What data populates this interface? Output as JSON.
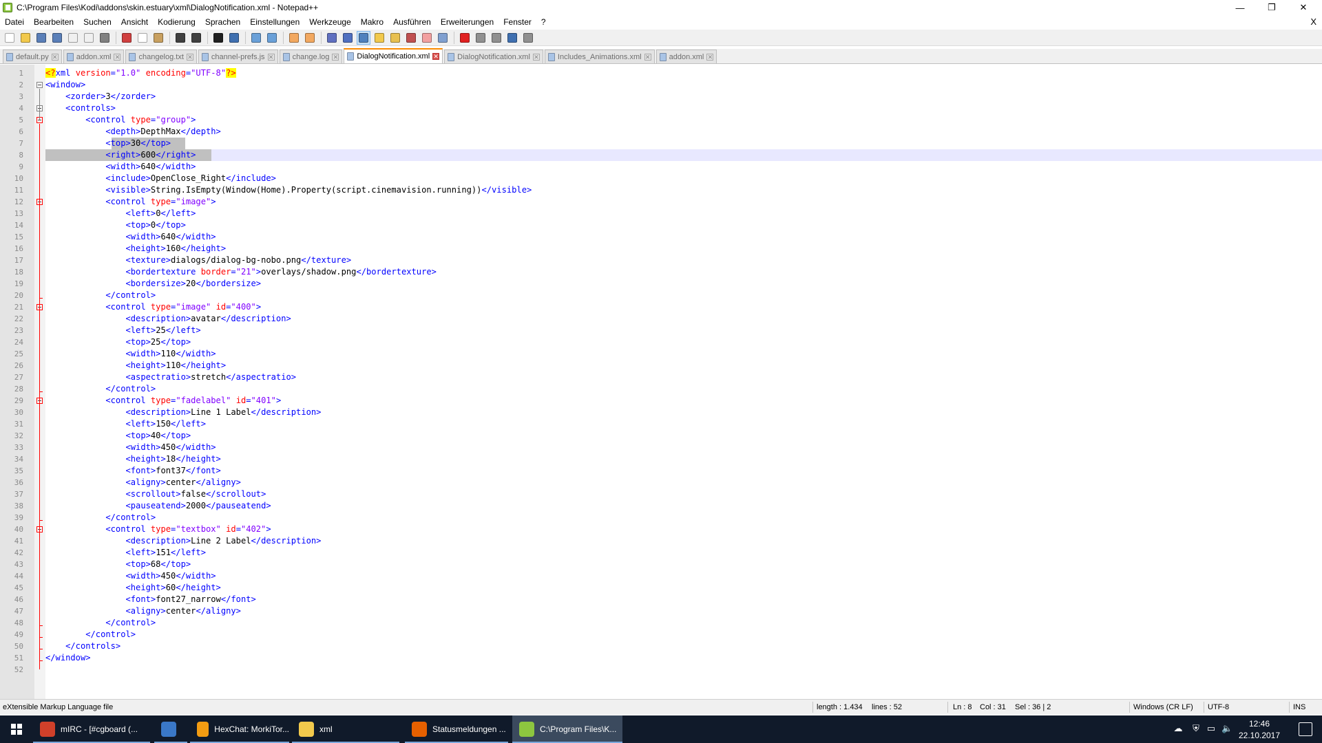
{
  "window": {
    "title": "C:\\Program Files\\Kodi\\addons\\skin.estuary\\xml\\DialogNotification.xml - Notepad++",
    "min_glyph": "—",
    "max_glyph": "❐",
    "close_glyph": "✕"
  },
  "menu": {
    "items": [
      "Datei",
      "Bearbeiten",
      "Suchen",
      "Ansicht",
      "Kodierung",
      "Sprachen",
      "Einstellungen",
      "Werkzeuge",
      "Makro",
      "Ausführen",
      "Erweiterungen",
      "Fenster",
      "?"
    ],
    "close_glyph": "X"
  },
  "toolbar": {
    "icons": [
      {
        "name": "new-file-icon",
        "color": "#ffffff"
      },
      {
        "name": "open-file-icon",
        "color": "#f2c94c"
      },
      {
        "name": "save-icon",
        "color": "#5a7fb8"
      },
      {
        "name": "save-all-icon",
        "color": "#5a7fb8"
      },
      {
        "name": "close-icon",
        "color": "#f0f0f0"
      },
      {
        "name": "close-all-icon",
        "color": "#f0f0f0"
      },
      {
        "name": "print-icon",
        "color": "#808080"
      },
      {
        "sep": true
      },
      {
        "name": "cut-icon",
        "color": "#d04040"
      },
      {
        "name": "copy-icon",
        "color": "#ffffff"
      },
      {
        "name": "paste-icon",
        "color": "#c8a060"
      },
      {
        "sep": true
      },
      {
        "name": "undo-icon",
        "color": "#404040"
      },
      {
        "name": "redo-icon",
        "color": "#404040"
      },
      {
        "sep": true
      },
      {
        "name": "find-icon",
        "color": "#202020"
      },
      {
        "name": "replace-icon",
        "color": "#4070b0"
      },
      {
        "sep": true
      },
      {
        "name": "zoom-in-icon",
        "color": "#6aa0d8"
      },
      {
        "name": "zoom-out-icon",
        "color": "#6aa0d8"
      },
      {
        "sep": true
      },
      {
        "name": "sync-vertical-icon",
        "color": "#f2a860"
      },
      {
        "name": "sync-horizontal-icon",
        "color": "#f2a860"
      },
      {
        "sep": true
      },
      {
        "name": "word-wrap-icon",
        "color": "#6070c0"
      },
      {
        "name": "show-all-chars-icon",
        "color": "#5070c0"
      },
      {
        "name": "indent-guide-icon",
        "color": "#4f81bd",
        "active": true
      },
      {
        "name": "lang-define-icon",
        "color": "#f2c94c"
      },
      {
        "name": "doc-map-icon",
        "color": "#e8c050"
      },
      {
        "name": "function-list-icon",
        "color": "#c05050"
      },
      {
        "name": "folder-workspace-icon",
        "color": "#f2a0a0"
      },
      {
        "name": "monitoring-icon",
        "color": "#80a0d0"
      },
      {
        "sep": true
      },
      {
        "name": "macro-record-icon",
        "color": "#e02020"
      },
      {
        "name": "macro-stop-icon",
        "color": "#909090"
      },
      {
        "name": "macro-play-icon",
        "color": "#909090"
      },
      {
        "name": "macro-run-multiple-icon",
        "color": "#4070b0"
      },
      {
        "name": "macro-save-icon",
        "color": "#909090"
      }
    ]
  },
  "tabs": [
    {
      "label": "default.py",
      "active": false,
      "icon": "blue"
    },
    {
      "label": "addon.xml",
      "active": false,
      "icon": "blue"
    },
    {
      "label": "changelog.txt",
      "active": false,
      "icon": "blue"
    },
    {
      "label": "channel-prefs.js",
      "active": false,
      "icon": "blue"
    },
    {
      "label": "change.log",
      "active": false,
      "icon": "blue"
    },
    {
      "label": "DialogNotification.xml",
      "active": true,
      "icon": "blue"
    },
    {
      "label": "DialogNotification.xml",
      "active": false,
      "icon": "blue"
    },
    {
      "label": "Includes_Animations.xml",
      "active": false,
      "icon": "blue"
    },
    {
      "label": "addon.xml",
      "active": false,
      "icon": "blue"
    }
  ],
  "tab_close_glyph": "✕",
  "editor": {
    "current_line": 8,
    "lines": [
      [
        [
          "pihl",
          "<?"
        ],
        [
          "pi",
          "xml "
        ],
        [
          "attr",
          "version"
        ],
        [
          "pi",
          "="
        ],
        [
          "val",
          "\"1.0\""
        ],
        [
          "pi",
          " "
        ],
        [
          "attr",
          "encoding"
        ],
        [
          "pi",
          "="
        ],
        [
          "val",
          "\"UTF-8\""
        ],
        [
          "pihl",
          "?>"
        ]
      ],
      [
        [
          "tag",
          "<window>"
        ]
      ],
      [
        [
          "ws",
          "    "
        ],
        [
          "tag",
          "<zorder>"
        ],
        [
          "text",
          "3"
        ],
        [
          "tag",
          "</zorder>"
        ]
      ],
      [
        [
          "ws",
          "    "
        ],
        [
          "tag",
          "<controls>"
        ]
      ],
      [
        [
          "ws",
          "        "
        ],
        [
          "tag",
          "<control "
        ],
        [
          "attr",
          "type"
        ],
        [
          "tag",
          "="
        ],
        [
          "val",
          "\"group\""
        ],
        [
          "tag",
          ">"
        ]
      ],
      [
        [
          "ws",
          "            "
        ],
        [
          "tag",
          "<depth>"
        ],
        [
          "text",
          "DepthMax"
        ],
        [
          "tag",
          "</depth>"
        ]
      ],
      [
        [
          "ws",
          "            "
        ],
        [
          "tag",
          "<top>"
        ],
        [
          "text",
          "30"
        ],
        [
          "tag",
          "</top>"
        ]
      ],
      [
        [
          "ws",
          "            "
        ],
        [
          "tag",
          "<right>"
        ],
        [
          "text",
          "600"
        ],
        [
          "tag",
          "</right>"
        ]
      ],
      [
        [
          "ws",
          "            "
        ],
        [
          "tag",
          "<width>"
        ],
        [
          "text",
          "640"
        ],
        [
          "tag",
          "</width>"
        ]
      ],
      [
        [
          "ws",
          "            "
        ],
        [
          "tag",
          "<include>"
        ],
        [
          "text",
          "OpenClose_Right"
        ],
        [
          "tag",
          "</include>"
        ]
      ],
      [
        [
          "ws",
          "            "
        ],
        [
          "tag",
          "<visible>"
        ],
        [
          "text",
          "String.IsEmpty(Window(Home).Property(script.cinemavision.running))"
        ],
        [
          "tag",
          "</visible>"
        ]
      ],
      [
        [
          "ws",
          "            "
        ],
        [
          "tag",
          "<control "
        ],
        [
          "attr",
          "type"
        ],
        [
          "tag",
          "="
        ],
        [
          "val",
          "\"image\""
        ],
        [
          "tag",
          ">"
        ]
      ],
      [
        [
          "ws",
          "                "
        ],
        [
          "tag",
          "<left>"
        ],
        [
          "text",
          "0"
        ],
        [
          "tag",
          "</left>"
        ]
      ],
      [
        [
          "ws",
          "                "
        ],
        [
          "tag",
          "<top>"
        ],
        [
          "text",
          "0"
        ],
        [
          "tag",
          "</top>"
        ]
      ],
      [
        [
          "ws",
          "                "
        ],
        [
          "tag",
          "<width>"
        ],
        [
          "text",
          "640"
        ],
        [
          "tag",
          "</width>"
        ]
      ],
      [
        [
          "ws",
          "                "
        ],
        [
          "tag",
          "<height>"
        ],
        [
          "text",
          "160"
        ],
        [
          "tag",
          "</height>"
        ]
      ],
      [
        [
          "ws",
          "                "
        ],
        [
          "tag",
          "<texture>"
        ],
        [
          "text",
          "dialogs/dialog-bg-nobo.png"
        ],
        [
          "tag",
          "</texture>"
        ]
      ],
      [
        [
          "ws",
          "                "
        ],
        [
          "tag",
          "<bordertexture "
        ],
        [
          "attr",
          "border"
        ],
        [
          "tag",
          "="
        ],
        [
          "val",
          "\"21\""
        ],
        [
          "tag",
          ">"
        ],
        [
          "text",
          "overlays/shadow.png"
        ],
        [
          "tag",
          "</bordertexture>"
        ]
      ],
      [
        [
          "ws",
          "                "
        ],
        [
          "tag",
          "<bordersize>"
        ],
        [
          "text",
          "20"
        ],
        [
          "tag",
          "</bordersize>"
        ]
      ],
      [
        [
          "ws",
          "            "
        ],
        [
          "tag",
          "</control>"
        ]
      ],
      [
        [
          "ws",
          "            "
        ],
        [
          "tag",
          "<control "
        ],
        [
          "attr",
          "type"
        ],
        [
          "tag",
          "="
        ],
        [
          "val",
          "\"image\""
        ],
        [
          "tag",
          " "
        ],
        [
          "attr",
          "id"
        ],
        [
          "tag",
          "="
        ],
        [
          "val",
          "\"400\""
        ],
        [
          "tag",
          ">"
        ]
      ],
      [
        [
          "ws",
          "                "
        ],
        [
          "tag",
          "<description>"
        ],
        [
          "text",
          "avatar"
        ],
        [
          "tag",
          "</description>"
        ]
      ],
      [
        [
          "ws",
          "                "
        ],
        [
          "tag",
          "<left>"
        ],
        [
          "text",
          "25"
        ],
        [
          "tag",
          "</left>"
        ]
      ],
      [
        [
          "ws",
          "                "
        ],
        [
          "tag",
          "<top>"
        ],
        [
          "text",
          "25"
        ],
        [
          "tag",
          "</top>"
        ]
      ],
      [
        [
          "ws",
          "                "
        ],
        [
          "tag",
          "<width>"
        ],
        [
          "text",
          "110"
        ],
        [
          "tag",
          "</width>"
        ]
      ],
      [
        [
          "ws",
          "                "
        ],
        [
          "tag",
          "<height>"
        ],
        [
          "text",
          "110"
        ],
        [
          "tag",
          "</height>"
        ]
      ],
      [
        [
          "ws",
          "                "
        ],
        [
          "tag",
          "<aspectratio>"
        ],
        [
          "text",
          "stretch"
        ],
        [
          "tag",
          "</aspectratio>"
        ]
      ],
      [
        [
          "ws",
          "            "
        ],
        [
          "tag",
          "</control>"
        ]
      ],
      [
        [
          "ws",
          "            "
        ],
        [
          "tag",
          "<control "
        ],
        [
          "attr",
          "type"
        ],
        [
          "tag",
          "="
        ],
        [
          "val",
          "\"fadelabel\""
        ],
        [
          "tag",
          " "
        ],
        [
          "attr",
          "id"
        ],
        [
          "tag",
          "="
        ],
        [
          "val",
          "\"401\""
        ],
        [
          "tag",
          ">"
        ]
      ],
      [
        [
          "ws",
          "                "
        ],
        [
          "tag",
          "<description>"
        ],
        [
          "text",
          "Line 1 Label"
        ],
        [
          "tag",
          "</description>"
        ]
      ],
      [
        [
          "ws",
          "                "
        ],
        [
          "tag",
          "<left>"
        ],
        [
          "text",
          "150"
        ],
        [
          "tag",
          "</left>"
        ]
      ],
      [
        [
          "ws",
          "                "
        ],
        [
          "tag",
          "<top>"
        ],
        [
          "text",
          "40"
        ],
        [
          "tag",
          "</top>"
        ]
      ],
      [
        [
          "ws",
          "                "
        ],
        [
          "tag",
          "<width>"
        ],
        [
          "text",
          "450"
        ],
        [
          "tag",
          "</width>"
        ]
      ],
      [
        [
          "ws",
          "                "
        ],
        [
          "tag",
          "<height>"
        ],
        [
          "text",
          "18"
        ],
        [
          "tag",
          "</height>"
        ]
      ],
      [
        [
          "ws",
          "                "
        ],
        [
          "tag",
          "<font>"
        ],
        [
          "text",
          "font37"
        ],
        [
          "tag",
          "</font>"
        ]
      ],
      [
        [
          "ws",
          "                "
        ],
        [
          "tag",
          "<aligny>"
        ],
        [
          "text",
          "center"
        ],
        [
          "tag",
          "</aligny>"
        ]
      ],
      [
        [
          "ws",
          "                "
        ],
        [
          "tag",
          "<scrollout>"
        ],
        [
          "text",
          "false"
        ],
        [
          "tag",
          "</scrollout>"
        ]
      ],
      [
        [
          "ws",
          "                "
        ],
        [
          "tag",
          "<pauseatend>"
        ],
        [
          "text",
          "2000"
        ],
        [
          "tag",
          "</pauseatend>"
        ]
      ],
      [
        [
          "ws",
          "            "
        ],
        [
          "tag",
          "</control>"
        ]
      ],
      [
        [
          "ws",
          "            "
        ],
        [
          "tag",
          "<control "
        ],
        [
          "attr",
          "type"
        ],
        [
          "tag",
          "="
        ],
        [
          "val",
          "\"textbox\""
        ],
        [
          "tag",
          " "
        ],
        [
          "attr",
          "id"
        ],
        [
          "tag",
          "="
        ],
        [
          "val",
          "\"402\""
        ],
        [
          "tag",
          ">"
        ]
      ],
      [
        [
          "ws",
          "                "
        ],
        [
          "tag",
          "<description>"
        ],
        [
          "text",
          "Line 2 Label"
        ],
        [
          "tag",
          "</description>"
        ]
      ],
      [
        [
          "ws",
          "                "
        ],
        [
          "tag",
          "<left>"
        ],
        [
          "text",
          "151"
        ],
        [
          "tag",
          "</left>"
        ]
      ],
      [
        [
          "ws",
          "                "
        ],
        [
          "tag",
          "<top>"
        ],
        [
          "text",
          "68"
        ],
        [
          "tag",
          "</top>"
        ]
      ],
      [
        [
          "ws",
          "                "
        ],
        [
          "tag",
          "<width>"
        ],
        [
          "text",
          "450"
        ],
        [
          "tag",
          "</width>"
        ]
      ],
      [
        [
          "ws",
          "                "
        ],
        [
          "tag",
          "<height>"
        ],
        [
          "text",
          "60"
        ],
        [
          "tag",
          "</height>"
        ]
      ],
      [
        [
          "ws",
          "                "
        ],
        [
          "tag",
          "<font>"
        ],
        [
          "text",
          "font27_narrow"
        ],
        [
          "tag",
          "</font>"
        ]
      ],
      [
        [
          "ws",
          "                "
        ],
        [
          "tag",
          "<aligny>"
        ],
        [
          "text",
          "center"
        ],
        [
          "tag",
          "</aligny>"
        ]
      ],
      [
        [
          "ws",
          "            "
        ],
        [
          "tag",
          "</control>"
        ]
      ],
      [
        [
          "ws",
          "        "
        ],
        [
          "tag",
          "</control>"
        ]
      ],
      [
        [
          "ws",
          "    "
        ],
        [
          "tag",
          "</controls>"
        ]
      ],
      [
        [
          "tag",
          "</window>"
        ]
      ],
      []
    ]
  },
  "statusbar": {
    "filetype": "eXtensible Markup Language file",
    "length": "length : 1.434",
    "lines": "lines : 52",
    "ln": "Ln : 8",
    "col": "Col : 31",
    "sel": "Sel : 36 | 2",
    "eol": "Windows (CR LF)",
    "encoding": "UTF-8",
    "mode": "INS"
  },
  "taskbar": {
    "tasks": [
      {
        "label": "mIRC - [#cgboard (...",
        "icon_color": "#d0402a",
        "running": true,
        "active": false
      },
      {
        "label": "",
        "icon_color": "#3a78c8",
        "running": true,
        "active": false
      },
      {
        "label": "HexChat: MorkiTor...",
        "icon_color": "#f39c12",
        "running": true,
        "active": false
      },
      {
        "label": "xml",
        "icon_color": "#f2c94c",
        "running": true,
        "active": false
      },
      {
        "label": "Statusmeldungen ...",
        "icon_color": "#e66000",
        "running": true,
        "active": false
      },
      {
        "label": "C:\\Program Files\\K...",
        "icon_color": "#8dc63f",
        "running": true,
        "active": true
      }
    ],
    "clock_time": "12:46",
    "clock_date": "22.10.2017",
    "tray_icons": [
      "cloud-icon",
      "defender-icon",
      "network-icon",
      "volume-icon"
    ]
  }
}
